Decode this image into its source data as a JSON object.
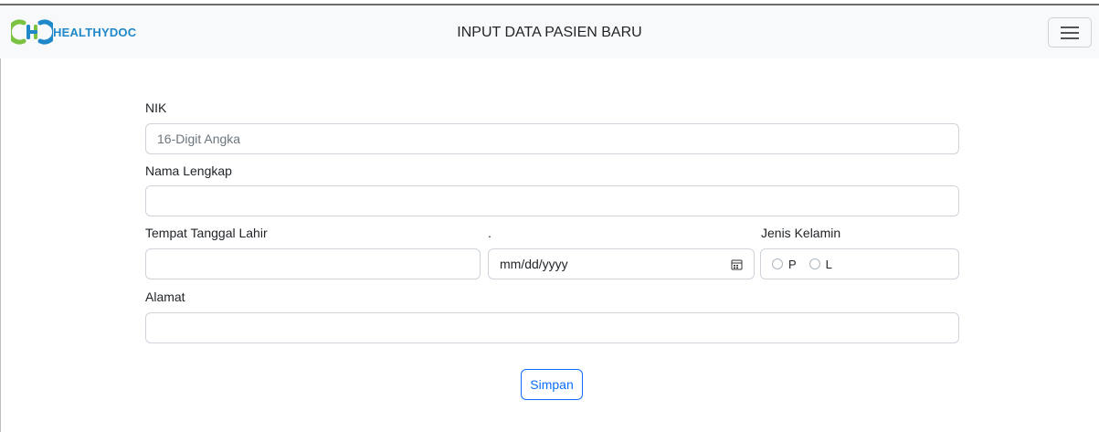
{
  "navbar": {
    "brand_name": "HEALTHYDOC",
    "title": "INPUT DATA PASIEN BARU",
    "brand_colors": {
      "blue": "#1e88c8",
      "green": "#7cc242"
    },
    "toggler_icon": "hamburger-menu-icon"
  },
  "form": {
    "nik": {
      "label": "NIK",
      "placeholder": "16-Digit Angka",
      "value": ""
    },
    "nama": {
      "label": "Nama Lengkap",
      "value": ""
    },
    "tempat": {
      "label": "Tempat Tanggal Lahir",
      "value": ""
    },
    "tanggal": {
      "label": ".",
      "placeholder": "mm/dd/yyyy",
      "icon": "calendar-icon"
    },
    "jenis_kelamin": {
      "label": "Jenis Kelamin",
      "options": [
        "P",
        "L"
      ]
    },
    "alamat": {
      "label": "Alamat",
      "value": ""
    },
    "submit_label": "Simpan"
  },
  "colors": {
    "accent": "#0d6efd",
    "navbar_bg": "#f8f9fa"
  }
}
